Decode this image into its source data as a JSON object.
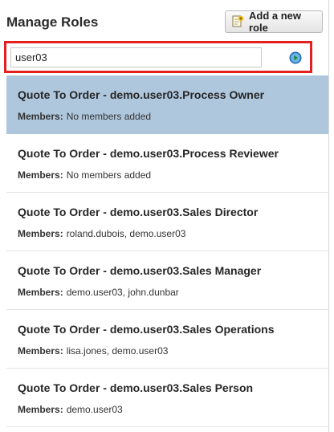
{
  "header": {
    "title": "Manage Roles",
    "add_button_label": "Add a new role"
  },
  "search": {
    "value": "user03",
    "placeholder": ""
  },
  "members_label": "Members:",
  "roles": [
    {
      "name": "Quote To Order - demo.user03.Process Owner",
      "members": "No members added",
      "selected": true
    },
    {
      "name": "Quote To Order - demo.user03.Process Reviewer",
      "members": "No members added",
      "selected": false
    },
    {
      "name": "Quote To Order - demo.user03.Sales Director",
      "members": "roland.dubois, demo.user03",
      "selected": false
    },
    {
      "name": "Quote To Order - demo.user03.Sales Manager",
      "members": "demo.user03, john.dunbar",
      "selected": false
    },
    {
      "name": "Quote To Order - demo.user03.Sales Operations",
      "members": "lisa.jones, demo.user03",
      "selected": false
    },
    {
      "name": "Quote To Order - demo.user03.Sales Person",
      "members": "demo.user03",
      "selected": false
    }
  ],
  "colors": {
    "selected_row": "#afc7dd",
    "highlight_border": "#e41f1f",
    "go_button": "#3a8fd6"
  },
  "icons": {
    "add": "add-role-icon",
    "go": "go-arrow-icon"
  }
}
